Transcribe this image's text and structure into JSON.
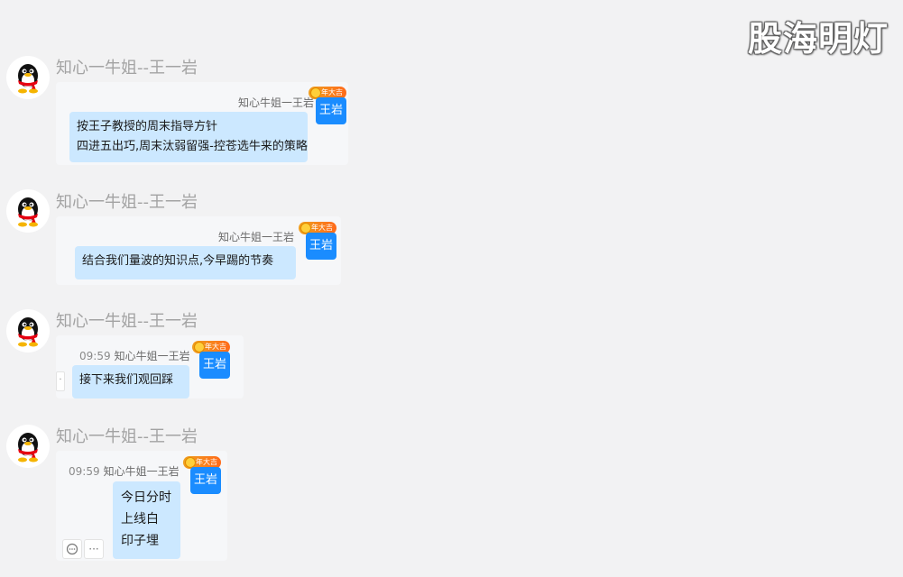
{
  "watermark": "股海明灯",
  "messages": [
    {
      "sender": "知心一牛姐--王一岩",
      "nickname": "知心牛姐一王岩",
      "badge_text": "王岩",
      "badge_banner": "龙年大吉",
      "lines": [
        "按王子教授的周末指导方针",
        "四进五出巧,周末汰弱留强-控苍选牛来的策略"
      ]
    },
    {
      "sender": "知心一牛姐--王一岩",
      "nickname": "知心牛姐一王岩",
      "badge_text": "王岩",
      "badge_banner": "龙年大吉",
      "lines": [
        "结合我们量波的知识点,今早踢的节奏"
      ]
    },
    {
      "sender": "知心一牛姐--王一岩",
      "time": "09:59",
      "nickname": "知心牛姐一王岩",
      "badge_text": "王岩",
      "badge_banner": "龙年大吉",
      "lines": [
        "接下来我们观回踩"
      ]
    },
    {
      "sender": "知心一牛姐--王一岩",
      "time": "09:59",
      "nickname": "知心牛姐一王岩",
      "badge_text": "王岩",
      "badge_banner": "龙年大吉",
      "lines": [
        "今日分时",
        "上线白",
        "印子埋"
      ]
    }
  ],
  "toolbar": {
    "comment_icon": "comment-icon",
    "more_icon": "more-icon",
    "more_glyph": "···",
    "dot_glyph": "·"
  }
}
